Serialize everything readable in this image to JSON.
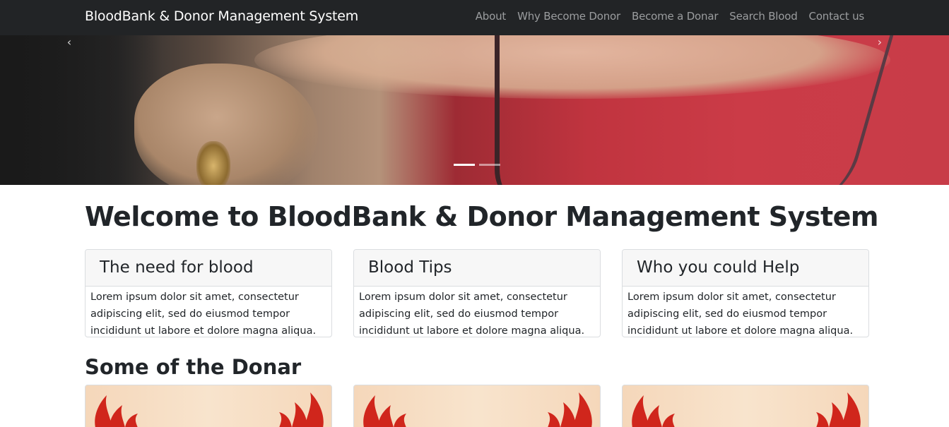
{
  "navbar": {
    "brand": "BloodBank & Donor Management System",
    "links": [
      "About",
      "Why Become Donor",
      "Become a Donar",
      "Search Blood",
      "Contact us"
    ]
  },
  "carousel": {
    "prev_icon": "chevron-left-icon",
    "next_icon": "chevron-right-icon",
    "slide_count": 2,
    "active_slide": 1
  },
  "main": {
    "welcome_title": "Welcome to BloodBank & Donor Management System",
    "cards": [
      {
        "title": "The need for blood",
        "body": "Lorem ipsum dolor sit amet, consectetur adipiscing elit, sed do eiusmod tempor incididunt ut labore et dolore magna aliqua."
      },
      {
        "title": "Blood Tips",
        "body": "Lorem ipsum dolor sit amet, consectetur adipiscing elit, sed do eiusmod tempor incididunt ut labore et dolore magna aliqua."
      },
      {
        "title": "Who you could Help",
        "body": "Lorem ipsum dolor sit amet, consectetur adipiscing elit, sed do eiusmod tempor incididunt ut labore et dolore magna aliqua."
      }
    ],
    "donors_title": "Some of the Donar"
  },
  "colors": {
    "navbar_bg": "#222426",
    "nav_link": "#9b9d9f",
    "card_header_bg": "#f7f7f7",
    "blood_red": "#d0261c"
  }
}
